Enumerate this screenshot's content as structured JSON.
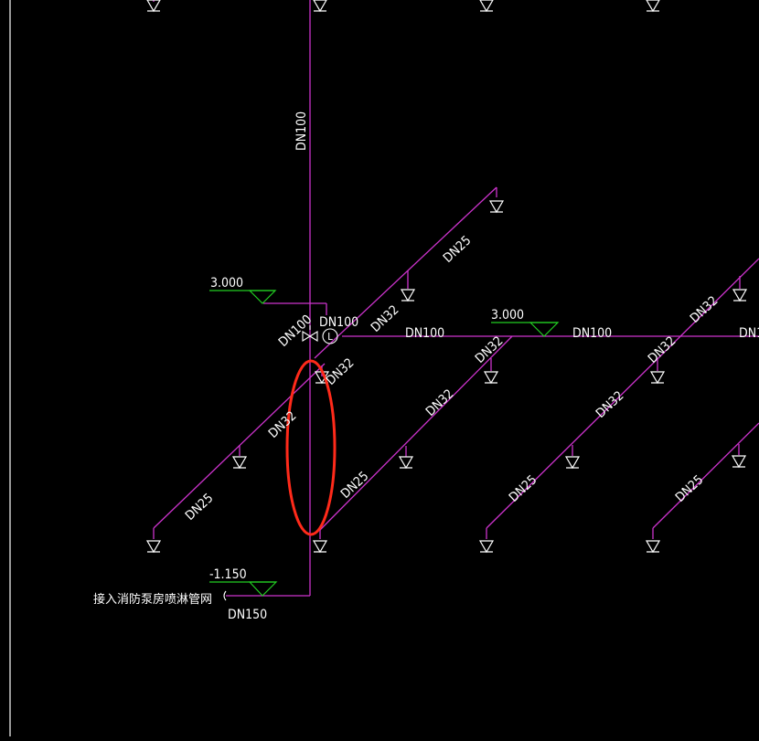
{
  "colors": {
    "background": "#000000",
    "pipe": "#cc33cc",
    "symbol": "#ffffff",
    "elevation": "#22cc22",
    "highlight": "#ff2a1a",
    "text": "#ffffff"
  },
  "labels": {
    "main_riser": "DN100",
    "riser_at_valve": "DN100",
    "valve_top": "DN100",
    "header_left": "DN100",
    "header_right": "DN100",
    "header_end": "DN1",
    "upper_branch_a": "DN32",
    "upper_branch_b": "DN25",
    "center_dn32_a": "DN32",
    "center_dn32_b": "DN32",
    "center_dn25": "DN25",
    "left_dn32_a": "DN32",
    "left_dn32_b": "DN32",
    "left_dn25": "DN25",
    "mid_right_dn32_a": "DN32",
    "mid_right_dn32_b": "DN32",
    "mid_right_dn25": "DN25",
    "far_right_dn32": "DN32",
    "far_right_dn25": "DN25",
    "inlet_pipe": "DN150",
    "elevation_main": "3.000",
    "elevation_header": "3.000",
    "elevation_bottom": "-1.150",
    "inlet_note": "接入消防泵房喷淋管网",
    "gauge_symbol": "L"
  }
}
